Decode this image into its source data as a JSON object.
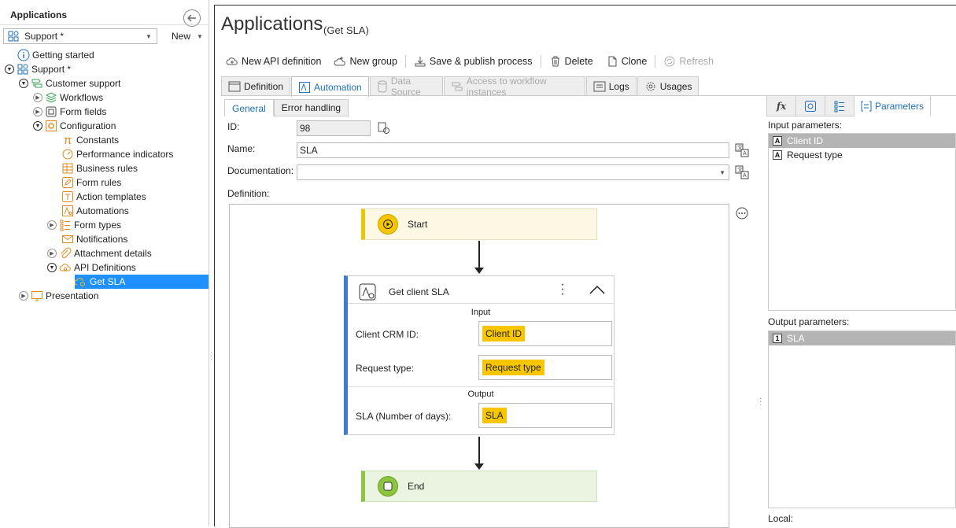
{
  "left_panel": {
    "title": "Applications",
    "app_select": "Support *",
    "new_label": "New",
    "tree": {
      "getting_started": "Getting started",
      "support": "Support *",
      "customer_support": "Customer support",
      "workflows": "Workflows",
      "form_fields": "Form fields",
      "configuration": "Configuration",
      "constants": "Constants",
      "performance_indicators": "Performance indicators",
      "business_rules": "Business rules",
      "form_rules": "Form rules",
      "action_templates": "Action templates",
      "automations": "Automations",
      "form_types": "Form types",
      "notifications": "Notifications",
      "attachment_details": "Attachment details",
      "api_definitions": "API Definitions",
      "get_sla": "Get SLA",
      "presentation": "Presentation"
    }
  },
  "header": {
    "title": "Applications",
    "subtitle": "(Get SLA)"
  },
  "toolbar": {
    "new_api": "New API definition",
    "new_group": "New group",
    "save_publish": "Save & publish process",
    "delete": "Delete",
    "clone": "Clone",
    "refresh": "Refresh"
  },
  "tabs": {
    "definition": "Definition",
    "automation": "Automation",
    "data_source": "Data Source",
    "access": "Access to workflow instances",
    "logs": "Logs",
    "usages": "Usages"
  },
  "subtabs": {
    "general": "General",
    "error_handling": "Error handling"
  },
  "form": {
    "id_label": "ID:",
    "id_value": "98",
    "name_label": "Name:",
    "name_value": "SLA",
    "doc_label": "Documentation:",
    "doc_value": "",
    "definition_label": "Definition:"
  },
  "flow": {
    "start": "Start",
    "end": "End",
    "api_step": {
      "title": "Get client SLA",
      "input_label": "Input",
      "output_label": "Output",
      "client_crm_label": "Client CRM ID:",
      "client_crm_value": "Client ID",
      "request_type_label": "Request type:",
      "request_type_value": "Request type",
      "sla_label": "SLA (Number of days):",
      "sla_value": "SLA"
    }
  },
  "right_panel": {
    "fx_label": "fx",
    "parameters_tab": "Parameters",
    "input_params_label": "Input parameters:",
    "input_params": [
      {
        "badge": "A",
        "name": "Client ID"
      },
      {
        "badge": "A",
        "name": "Request type"
      }
    ],
    "output_params_label": "Output parameters:",
    "output_params": [
      {
        "badge": "1",
        "name": "SLA"
      }
    ],
    "local_label": "Local:"
  },
  "colors": {
    "accent": "#1e90ff",
    "chip": "#f7c600",
    "start_bar": "#f0c400",
    "end_bar": "#8cc63f",
    "api_bar": "#3a7bd5"
  }
}
